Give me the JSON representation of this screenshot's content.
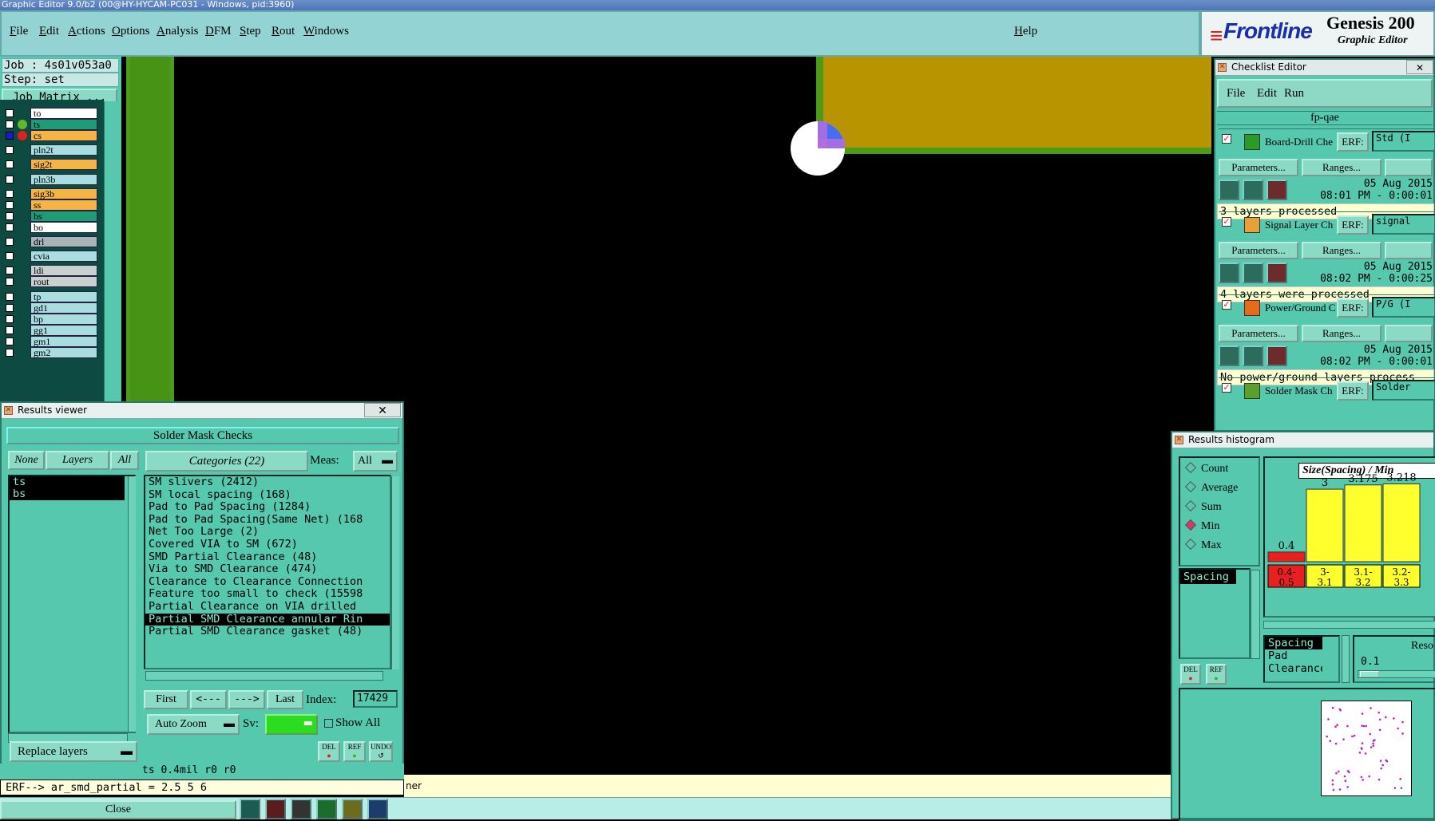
{
  "window": {
    "title": "Graphic Editor 9.0/b2 (00@HY-HYCAM-PC031 - Windows, pid:3960)"
  },
  "menu": {
    "items": [
      "File",
      "Edit",
      "Actions",
      "Options",
      "Analysis",
      "DFM",
      "Step",
      "Rout",
      "Windows"
    ],
    "help": "Help"
  },
  "brand": {
    "logo": "Frontline",
    "product": "Genesis 200",
    "subtitle": "Graphic Editor"
  },
  "job": {
    "job_label": "Job : 4s01v053a0",
    "step_label": "Step: set",
    "matrix_button": "Job Matrix ..."
  },
  "layers": [
    {
      "name": "to",
      "color": "#ffffff",
      "dot": ""
    },
    {
      "name": "ts",
      "color": "#1e9c76",
      "dot": "#5fba2a"
    },
    {
      "name": "cs",
      "color": "#f6b444",
      "dot": "#e0201e"
    },
    {
      "name": "pln2t",
      "color": "#aadde0",
      "dot": ""
    },
    {
      "name": "sig2t",
      "color": "#f6b444",
      "dot": ""
    },
    {
      "name": "pln3b",
      "color": "#aadde0",
      "dot": ""
    },
    {
      "name": "sig3b",
      "color": "#f6b444",
      "dot": ""
    },
    {
      "name": "ss",
      "color": "#f6b444",
      "dot": ""
    },
    {
      "name": "bs",
      "color": "#1e9c76",
      "dot": ""
    },
    {
      "name": "bo",
      "color": "#ffffff",
      "dot": ""
    },
    {
      "name": "drl",
      "color": "#a8b4b6",
      "dot": ""
    },
    {
      "name": "cvia",
      "color": "#aadde0",
      "dot": ""
    },
    {
      "name": "ldi",
      "color": "#c8d0d0",
      "dot": ""
    },
    {
      "name": "rout",
      "color": "#c8d0d0",
      "dot": ""
    },
    {
      "name": "tp",
      "color": "#aadde0",
      "dot": ""
    },
    {
      "name": "gd1",
      "color": "#aadde0",
      "dot": ""
    },
    {
      "name": "bp",
      "color": "#aadde0",
      "dot": ""
    },
    {
      "name": "gg1",
      "color": "#aadde0",
      "dot": ""
    },
    {
      "name": "gm1",
      "color": "#aadde0",
      "dot": ""
    },
    {
      "name": "gm2",
      "color": "#aadde0",
      "dot": ""
    }
  ],
  "results_viewer": {
    "title": "Results viewer",
    "header": "Solder Mask Checks",
    "none_btn": "None",
    "layers_btn": "Layers",
    "all_btn": "All",
    "categories_btn": "Categories (22)",
    "meas_label": "Meas:",
    "meas_value": "All",
    "layer_list": [
      "ts",
      "bs"
    ],
    "categories": [
      "SM slivers (2412)",
      "SM local spacing (168)",
      "Pad to Pad Spacing (1284)",
      "Pad to Pad Spacing(Same Net) (168",
      "Net Too Large (2)",
      "Covered VIA to SM (672)",
      "SMD Partial Clearance (48)",
      "Via to SMD Clearance (474)",
      "Clearance to Clearance Connection",
      "Feature too small to check (15598",
      "Partial Clearance on VIA drilled",
      "Partial SMD Clearance annular Rin",
      "Partial SMD Clearance gasket (48)"
    ],
    "selected_index": 11,
    "first": "First",
    "prev": "<---",
    "next": "--->",
    "last": "Last",
    "index_label": "Index:",
    "index_value": "17429",
    "auto_zoom": "Auto Zoom",
    "sv_label": "Sv:",
    "show_all": "Show All",
    "replace_layers": "Replace layers",
    "del": "DEL",
    "ref": "REF",
    "undo": "UNDO"
  },
  "status": {
    "line1": "ts 0.4mil  r0  r0",
    "erf": "ERF--> ar_smd_partial = 2.5 5 6",
    "close": "Close",
    "banner_tail": "ner"
  },
  "checklist": {
    "title": "Checklist Editor",
    "menu": [
      "File",
      "Edit",
      "Run"
    ],
    "name": "fp-qae",
    "checks": [
      {
        "label": "Board-Drill Che",
        "erf": "ERF:",
        "erf_value": "Std (I",
        "date": "05 Aug 2015",
        "time": "08:01 PM - 0:00:01",
        "message": "3 layers processed"
      },
      {
        "label": "Signal Layer Ch",
        "erf": "ERF:",
        "erf_value": "signal",
        "date": "05 Aug 2015",
        "time": "08:02 PM - 0:00:25",
        "message": "4 layers were processed"
      },
      {
        "label": "Power/Ground C",
        "erf": "ERF:",
        "erf_value": "P/G (I",
        "date": "05 Aug 2015",
        "time": "08:02 PM - 0:00:01",
        "message": "No power/ground layers process"
      },
      {
        "label": "Solder Mask Ch",
        "erf": "ERF:",
        "erf_value": "Solder"
      }
    ],
    "params_btn": "Parameters...",
    "ranges_btn": "Ranges..."
  },
  "histogram": {
    "title": "Results histogram",
    "modes": [
      "Count",
      "Average",
      "Sum",
      "Min",
      "Max"
    ],
    "selected_mode": "Min",
    "list": [
      "Spacing"
    ],
    "chart_title": "Size(Spacing) / Min",
    "bars": [
      {
        "label": "0.4",
        "range": "0.4-0.5",
        "value": 0.4,
        "color": "#e82020"
      },
      {
        "label": "3",
        "range": "3-3.1",
        "value": 3,
        "color": "#ffff2e"
      },
      {
        "label": "3.175",
        "range": "3.1-3.2",
        "value": 3.175,
        "color": "#ffff2e"
      },
      {
        "label": "3.218",
        "range": "3.2-3.3",
        "value": 3.218,
        "color": "#ffff2e"
      }
    ],
    "lower_list": [
      "Spacing",
      "Pad",
      "Clearance"
    ],
    "res_label": "Reso",
    "res_value": "0.1",
    "del": "DEL",
    "ref": "REF"
  }
}
